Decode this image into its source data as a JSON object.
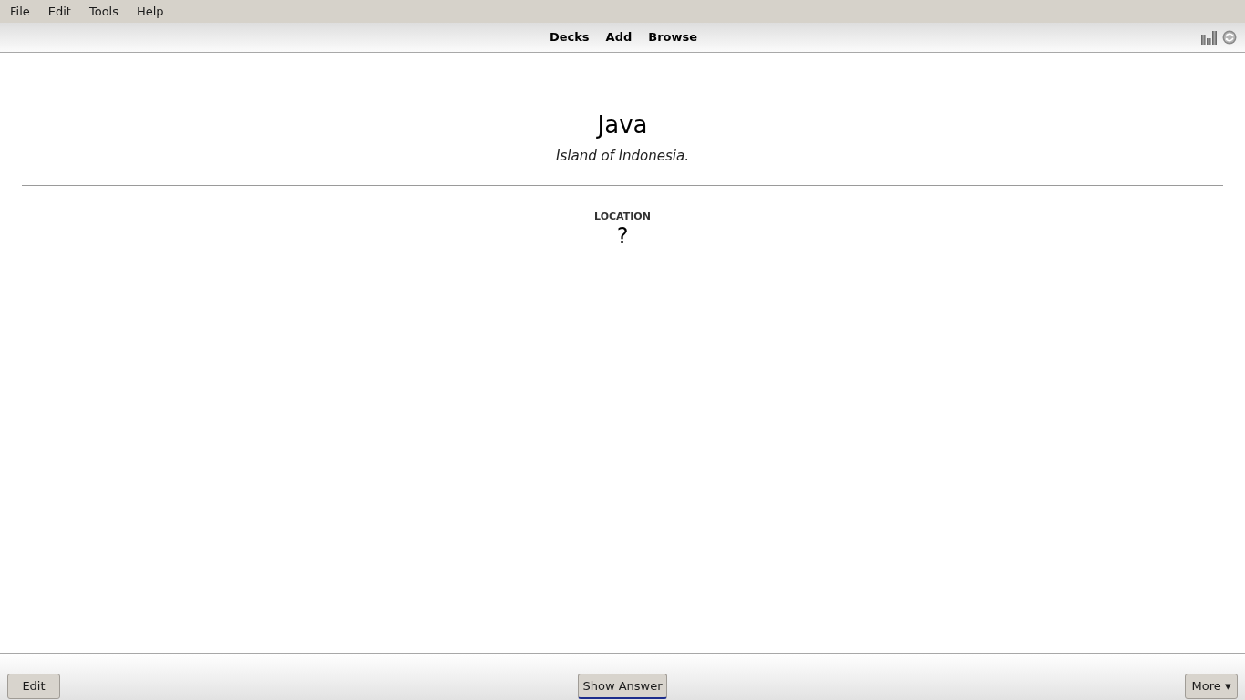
{
  "menu": [
    "File",
    "Edit",
    "Tools",
    "Help"
  ],
  "toolbar": {
    "links": [
      "Decks",
      "Add",
      "Browse"
    ]
  },
  "card": {
    "title": "Java",
    "subtitle": "Island of Indonesia.",
    "field_label": "LOCATION",
    "answer": "?"
  },
  "bottom_bar": {
    "left_button": "Edit",
    "center_button": {
      "label": "Show Answer",
      "focused": true
    },
    "right_button": "More ▾"
  }
}
